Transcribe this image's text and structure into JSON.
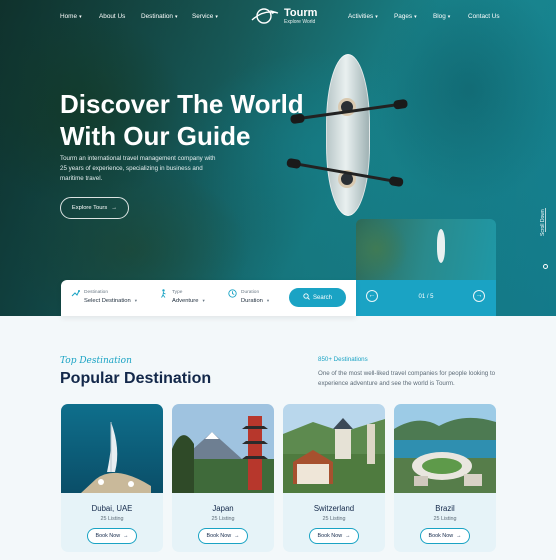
{
  "nav": {
    "items_left": [
      {
        "label": "Home",
        "has_dropdown": true
      },
      {
        "label": "About Us",
        "has_dropdown": false
      },
      {
        "label": "Destination",
        "has_dropdown": true
      },
      {
        "label": "Service",
        "has_dropdown": true
      }
    ],
    "items_right": [
      {
        "label": "Activities",
        "has_dropdown": true
      },
      {
        "label": "Pages",
        "has_dropdown": true
      },
      {
        "label": "Blog",
        "has_dropdown": true
      },
      {
        "label": "Contact Us",
        "has_dropdown": false
      }
    ],
    "logo": {
      "name": "Tourm",
      "tagline": "Explore World"
    }
  },
  "hero": {
    "title_line1": "Discover The World",
    "title_line2": "With Our Guide",
    "description": "Tourm an international travel management company with 25 years of experience, specializing in business and maritime travel.",
    "button_label": "Explore Tours",
    "scroll_label": "Scroll Down"
  },
  "search": {
    "fields": [
      {
        "label": "Destination",
        "value": "Select Destination",
        "icon": "map-pin-icon"
      },
      {
        "label": "Type",
        "value": "Adventure",
        "icon": "hiker-icon"
      },
      {
        "label": "Duration",
        "value": "Duration",
        "icon": "clock-icon"
      }
    ],
    "button_label": "Search"
  },
  "slider": {
    "counter": "01 / 5"
  },
  "destinations": {
    "kicker": "Top Destination",
    "title": "Popular Destination",
    "count_label": "850+ Destinations",
    "description": "One of the most well-liked travel companies for people looking to experience adventure and see the world is Tourm.",
    "cards": [
      {
        "name": "Dubai, UAE",
        "listing": "25 Listing",
        "button": "Book Now"
      },
      {
        "name": "Japan",
        "listing": "25 Listing",
        "button": "Book Now"
      },
      {
        "name": "Switzerland",
        "listing": "25 Listing",
        "button": "Book Now"
      },
      {
        "name": "Brazil",
        "listing": "25 Listing",
        "button": "Book Now"
      }
    ]
  },
  "colors": {
    "accent": "#1aa3c4",
    "heading": "#13284a",
    "section_bg": "#f3f8fa"
  }
}
